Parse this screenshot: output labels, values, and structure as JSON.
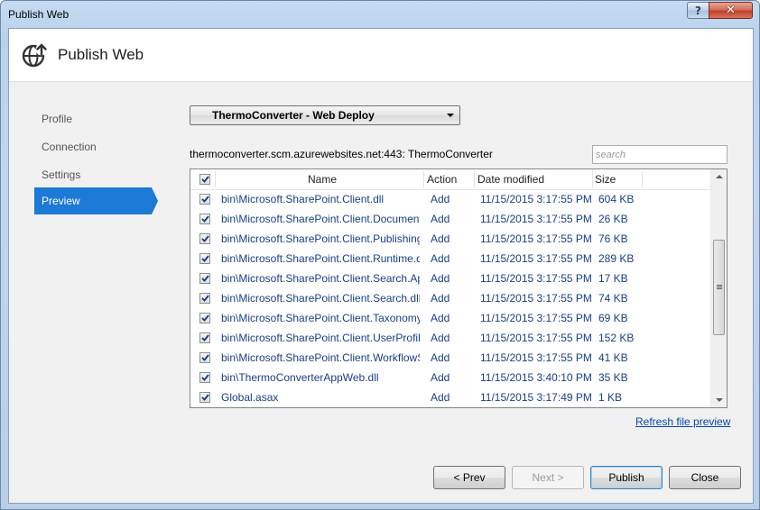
{
  "window": {
    "title": "Publish Web"
  },
  "header": {
    "title": "Publish Web",
    "icon": "globe-publish-icon"
  },
  "nav": {
    "items": [
      {
        "label": "Profile",
        "active": false
      },
      {
        "label": "Connection",
        "active": false
      },
      {
        "label": "Settings",
        "active": false
      },
      {
        "label": "Preview",
        "active": true
      }
    ]
  },
  "profile": {
    "selected": "ThermoConverter - Web Deploy"
  },
  "connection": {
    "text": "thermoconverter.scm.azurewebsites.net:443: ThermoConverter"
  },
  "search": {
    "placeholder": "search",
    "value": ""
  },
  "grid": {
    "columns": [
      "Name",
      "Action",
      "Date modified",
      "Size"
    ],
    "select_all_checked": true,
    "rows": [
      {
        "checked": true,
        "name": "bin\\Microsoft.SharePoint.Client.dll",
        "action": "Add",
        "date": "11/15/2015 3:17:55 PM",
        "size": "604 KB"
      },
      {
        "checked": true,
        "name": "bin\\Microsoft.SharePoint.Client.DocumentManagement.dll",
        "action": "Add",
        "date": "11/15/2015 3:17:55 PM",
        "size": "26 KB"
      },
      {
        "checked": true,
        "name": "bin\\Microsoft.SharePoint.Client.Publishing.dll",
        "action": "Add",
        "date": "11/15/2015 3:17:55 PM",
        "size": "76 KB"
      },
      {
        "checked": true,
        "name": "bin\\Microsoft.SharePoint.Client.Runtime.dll",
        "action": "Add",
        "date": "11/15/2015 3:17:55 PM",
        "size": "289 KB"
      },
      {
        "checked": true,
        "name": "bin\\Microsoft.SharePoint.Client.Search.Applications.dll",
        "action": "Add",
        "date": "11/15/2015 3:17:55 PM",
        "size": "17 KB"
      },
      {
        "checked": true,
        "name": "bin\\Microsoft.SharePoint.Client.Search.dll",
        "action": "Add",
        "date": "11/15/2015 3:17:55 PM",
        "size": "74 KB"
      },
      {
        "checked": true,
        "name": "bin\\Microsoft.SharePoint.Client.Taxonomy.dll",
        "action": "Add",
        "date": "11/15/2015 3:17:55 PM",
        "size": "69 KB"
      },
      {
        "checked": true,
        "name": "bin\\Microsoft.SharePoint.Client.UserProfiles.dll",
        "action": "Add",
        "date": "11/15/2015 3:17:55 PM",
        "size": "152 KB"
      },
      {
        "checked": true,
        "name": "bin\\Microsoft.SharePoint.Client.WorkflowServices.dll",
        "action": "Add",
        "date": "11/15/2015 3:17:55 PM",
        "size": "41 KB"
      },
      {
        "checked": true,
        "name": "bin\\ThermoConverterAppWeb.dll",
        "action": "Add",
        "date": "11/15/2015 3:40:10 PM",
        "size": "35 KB"
      },
      {
        "checked": true,
        "name": "Global.asax",
        "action": "Add",
        "date": "11/15/2015 3:17:49 PM",
        "size": "1 KB"
      }
    ]
  },
  "refresh_link": "Refresh file preview",
  "buttons": {
    "prev": "< Prev",
    "next": "Next >",
    "publish": "Publish",
    "close": "Close"
  },
  "colors": {
    "accent": "#1c7ad6",
    "link": "#0645ad",
    "row_text": "#1a3f86"
  }
}
